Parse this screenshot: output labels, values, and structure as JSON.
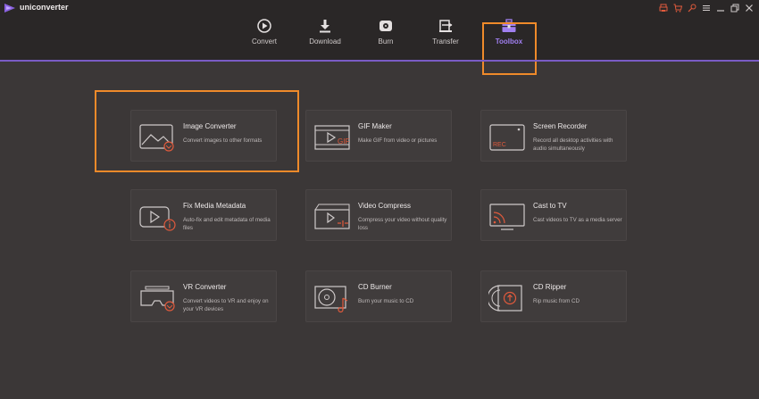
{
  "app": {
    "title": "uniconverter"
  },
  "colors": {
    "accent": "#7a5cc4",
    "highlight": "#ef8a2a",
    "icon_red": "#e05a3c",
    "background": "#3b3737"
  },
  "window_controls": [
    "printer-icon",
    "cart-icon",
    "key-icon",
    "menu-icon",
    "minimize-icon",
    "restore-icon",
    "close-icon"
  ],
  "nav": {
    "items": [
      {
        "label": "Convert",
        "icon": "convert-icon"
      },
      {
        "label": "Download",
        "icon": "download-icon"
      },
      {
        "label": "Burn",
        "icon": "burn-icon"
      },
      {
        "label": "Transfer",
        "icon": "transfer-icon"
      },
      {
        "label": "Toolbox",
        "icon": "toolbox-icon",
        "active": true
      }
    ]
  },
  "tools": [
    {
      "title": "Image Converter",
      "desc": "Convert images to other formats",
      "icon": "image-converter-icon"
    },
    {
      "title": "GIF Maker",
      "desc": "Make GIF from video or pictures",
      "icon": "gif-maker-icon"
    },
    {
      "title": "Screen Recorder",
      "desc": "Record all desktop activities with audio simultaneously",
      "icon": "screen-recorder-icon"
    },
    {
      "title": "Fix Media Metadata",
      "desc": "Auto-fix and edit metadata of media files",
      "icon": "fix-metadata-icon"
    },
    {
      "title": "Video Compress",
      "desc": "Compress your video without quality loss",
      "icon": "video-compress-icon"
    },
    {
      "title": "Cast to TV",
      "desc": "Cast videos to TV as a media server",
      "icon": "cast-tv-icon"
    },
    {
      "title": "VR Converter",
      "desc": "Convert videos to VR and enjoy on your VR devices",
      "icon": "vr-converter-icon"
    },
    {
      "title": "CD Burner",
      "desc": "Burn your music to CD",
      "icon": "cd-burner-icon"
    },
    {
      "title": "CD Ripper",
      "desc": "Rip music from CD",
      "icon": "cd-ripper-icon"
    }
  ]
}
